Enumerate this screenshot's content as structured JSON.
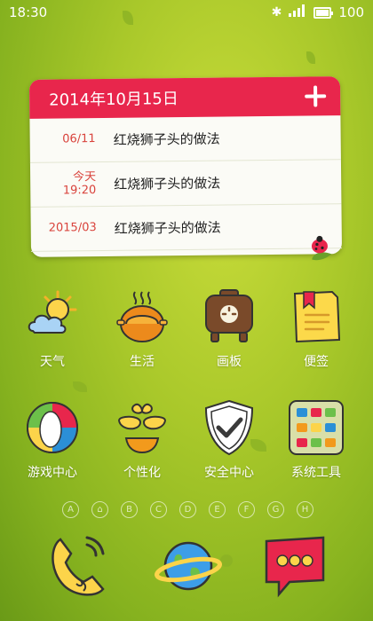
{
  "status_bar": {
    "time": "18:30",
    "battery": "100",
    "battery_level": 1.0
  },
  "widget": {
    "date": "2014年10月15日",
    "entries": [
      {
        "date": "06/11",
        "title": "红烧狮子头的做法"
      },
      {
        "date": "今天\n19:20",
        "title": "红烧狮子头的做法"
      },
      {
        "date": "2015/03",
        "title": "红烧狮子头的做法"
      }
    ]
  },
  "apps": [
    {
      "label": "天气",
      "icon": "weather-icon"
    },
    {
      "label": "生活",
      "icon": "life-icon"
    },
    {
      "label": "画板",
      "icon": "drawing-board-icon"
    },
    {
      "label": "便签",
      "icon": "notes-icon"
    },
    {
      "label": "游戏中心",
      "icon": "game-center-icon"
    },
    {
      "label": "个性化",
      "icon": "personalize-icon"
    },
    {
      "label": "安全中心",
      "icon": "security-icon"
    },
    {
      "label": "系统工具",
      "icon": "system-tools-icon"
    }
  ],
  "page_indicators": [
    "A",
    "⌂",
    "B",
    "C",
    "D",
    "E",
    "F",
    "G",
    "H"
  ],
  "dock": [
    {
      "icon": "phone-icon"
    },
    {
      "icon": "browser-icon"
    },
    {
      "icon": "messages-icon"
    }
  ],
  "colors": {
    "accent": "#e8264c",
    "background": "#a9c82a"
  }
}
